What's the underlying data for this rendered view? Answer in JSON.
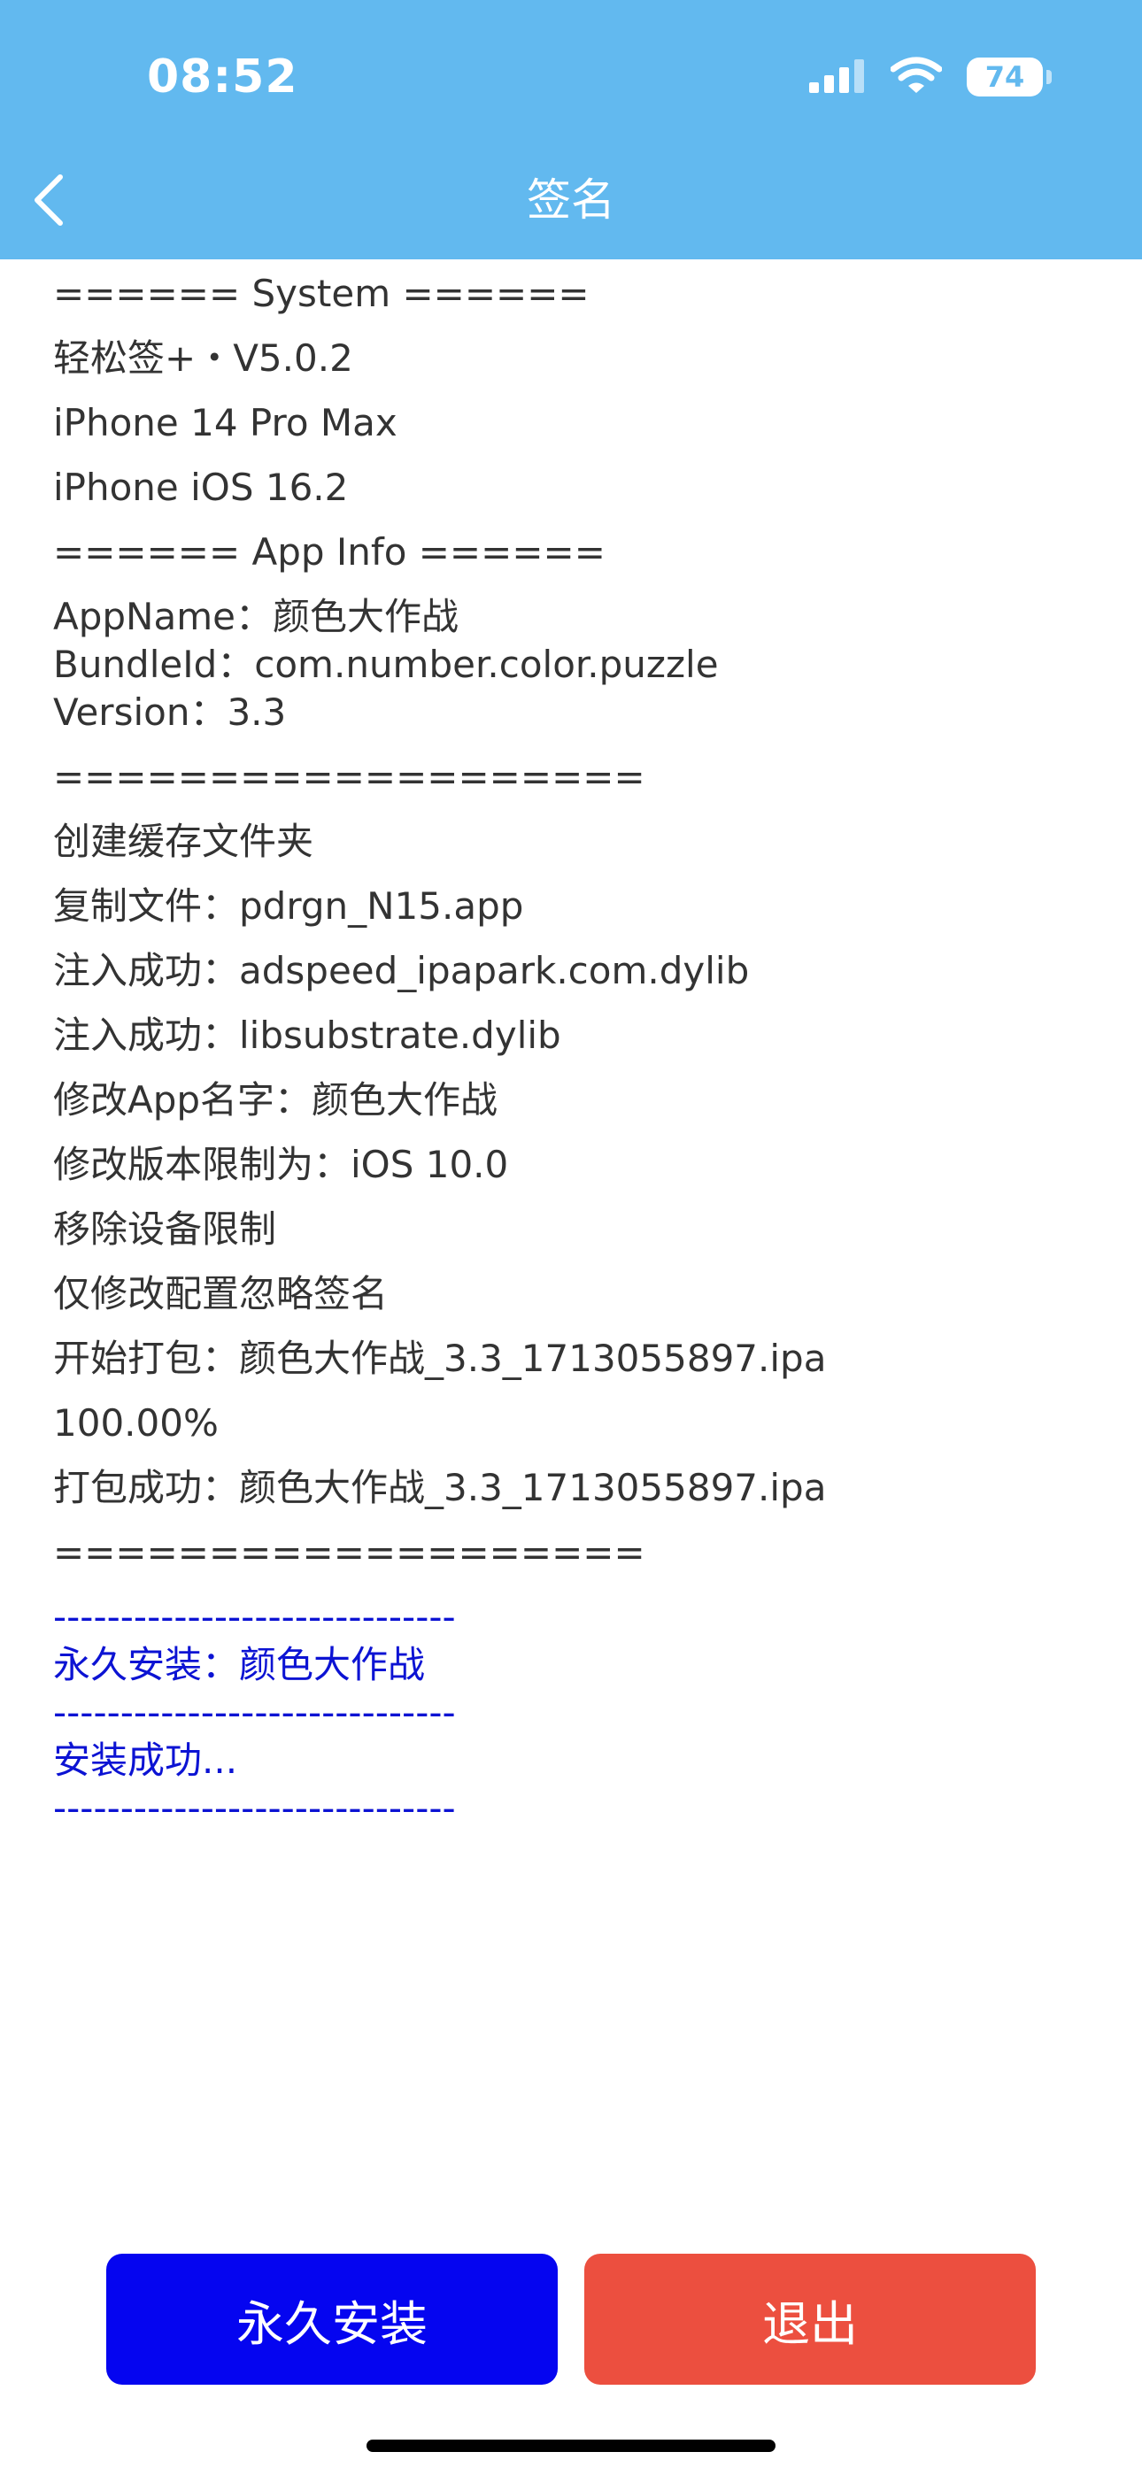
{
  "status_bar": {
    "time": "08:52",
    "battery": "74",
    "colors": {
      "bar": "#62b9ef",
      "text": "#ffffff"
    },
    "icons": [
      "signal-icon",
      "wifi-icon",
      "battery-icon"
    ]
  },
  "nav": {
    "title": "签名",
    "back_icon": "chevron-left-icon"
  },
  "log": {
    "lines": [
      "====== System ======",
      "轻松签+・V5.0.2",
      "iPhone 14 Pro Max",
      "iPhone iOS 16.2",
      "====== App Info ======",
      "AppName：颜色大作战",
      "BundleId：com.number.color.puzzle",
      "Version：3.3",
      "===================",
      "创建缓存文件夹",
      "复制文件：pdrgn_N15.app",
      "注入成功：adspeed_ipapark.com.dylib",
      "注入成功：libsubstrate.dylib",
      "修改App名字：颜色大作战",
      "修改版本限制为：iOS 10.0",
      "移除设备限制",
      "仅修改配置忽略签名",
      "开始打包：颜色大作战_3.3_1713055897.ipa",
      "100.00%",
      "打包成功：颜色大作战_3.3_1713055897.ipa",
      "==================="
    ],
    "install_lines": [
      "------------------------------",
      "永久安装：颜色大作战",
      "------------------------------",
      "安装成功...",
      "------------------------------"
    ],
    "colors": {
      "text": "#333333",
      "install_text": "#0c13d3"
    }
  },
  "actions": {
    "install_label": "永久安装",
    "exit_label": "退出",
    "colors": {
      "install": "#0505f0",
      "exit": "#ec4f3f"
    }
  }
}
